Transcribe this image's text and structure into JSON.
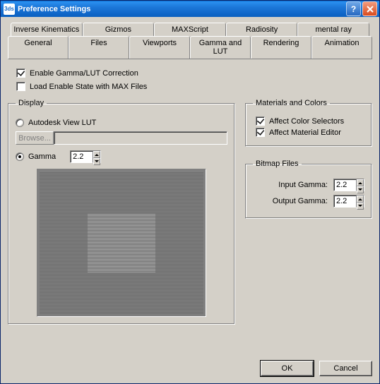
{
  "window": {
    "title": "Preference Settings"
  },
  "tabs": {
    "row1": [
      "Inverse Kinematics",
      "Gizmos",
      "MAXScript",
      "Radiosity",
      "mental ray"
    ],
    "row2": [
      "General",
      "Files",
      "Viewports",
      "Gamma and LUT",
      "Rendering",
      "Animation"
    ],
    "selected": "Gamma and LUT"
  },
  "checkboxes": {
    "enable_gamma": {
      "label": "Enable Gamma/LUT Correction",
      "checked": true
    },
    "load_state": {
      "label": "Load Enable State with MAX Files",
      "checked": false
    }
  },
  "display": {
    "legend": "Display",
    "autodesk_lut": {
      "label": "Autodesk View LUT",
      "checked": false
    },
    "browse": "Browse...",
    "gamma_radio": {
      "label": "Gamma",
      "checked": true
    },
    "gamma_value": "2.2"
  },
  "materials": {
    "legend": "Materials and Colors",
    "affect_selectors": {
      "label": "Affect Color Selectors",
      "checked": true
    },
    "affect_editor": {
      "label": "Affect Material Editor",
      "checked": true
    }
  },
  "bitmap": {
    "legend": "Bitmap Files",
    "input_label": "Input Gamma:",
    "input_value": "2.2",
    "output_label": "Output Gamma:",
    "output_value": "2.2"
  },
  "buttons": {
    "ok": "OK",
    "cancel": "Cancel"
  }
}
